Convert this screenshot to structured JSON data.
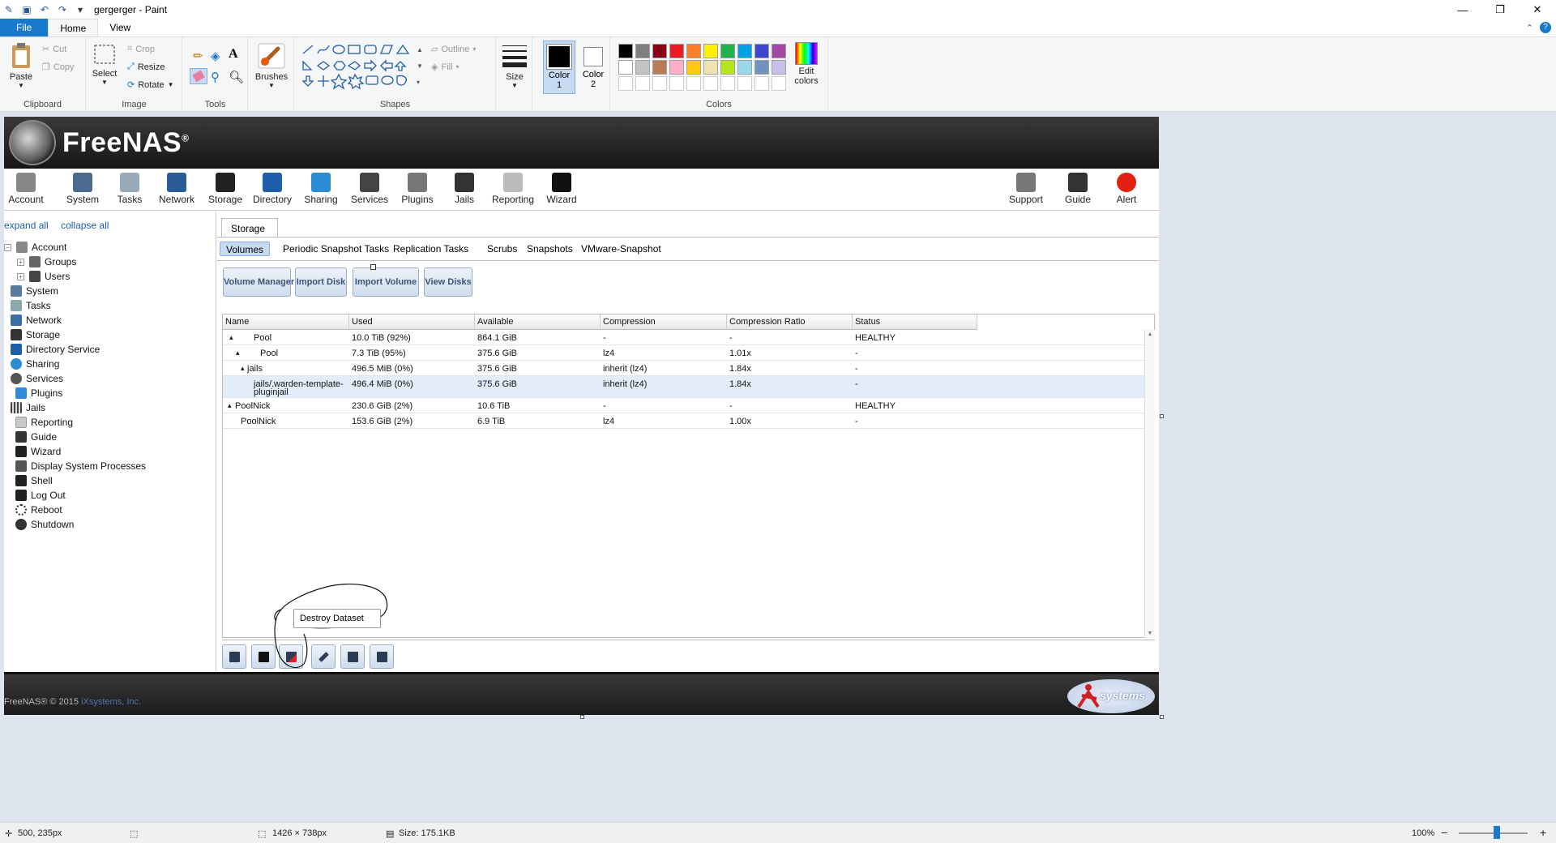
{
  "window": {
    "title": "gergerger - Paint",
    "min": "—",
    "max": "❐",
    "close": "✕"
  },
  "ribbon_tabs": {
    "file": "File",
    "home": "Home",
    "view": "View",
    "collapse": "⌃",
    "help": "?"
  },
  "ribbon": {
    "clipboard": {
      "label": "Clipboard",
      "paste": "Paste",
      "cut": "Cut",
      "copy": "Copy"
    },
    "image": {
      "label": "Image",
      "select": "Select",
      "crop": "Crop",
      "resize": "Resize",
      "rotate": "Rotate"
    },
    "tools": {
      "label": "Tools",
      "text_tool": "A"
    },
    "brushes": {
      "label": "Brushes"
    },
    "shapes": {
      "label": "Shapes",
      "outline": "Outline",
      "fill": "Fill"
    },
    "size": {
      "label": "Size"
    },
    "color1": {
      "label": "Color",
      "number": "1"
    },
    "color2": {
      "label": "Color",
      "number": "2"
    },
    "colors": {
      "label": "Colors",
      "edit_line1": "Edit",
      "edit_line2": "colors",
      "row1": [
        "#000000",
        "#7f7f7f",
        "#880015",
        "#ed1c24",
        "#ff7f27",
        "#fff200",
        "#22b14c",
        "#00a2e8",
        "#3f48cc",
        "#a349a4"
      ],
      "row2": [
        "#ffffff",
        "#c3c3c3",
        "#b97a57",
        "#ffaec9",
        "#ffc90e",
        "#efe4b0",
        "#b5e61d",
        "#99d9ea",
        "#7092be",
        "#c8bfe7"
      ]
    }
  },
  "freenas": {
    "brand": "FreeNAS",
    "trademark": "®",
    "nav": [
      "Account",
      "System",
      "Tasks",
      "Network",
      "Storage",
      "Directory",
      "Sharing",
      "Services",
      "Plugins",
      "Jails",
      "Reporting",
      "Wizard"
    ],
    "nav_right": [
      "Support",
      "Guide",
      "Alert"
    ],
    "tree_links": {
      "expand": "expand all",
      "collapse": "collapse all"
    },
    "tree": {
      "account": "Account",
      "groups": "Groups",
      "users": "Users",
      "system": "System",
      "tasks": "Tasks",
      "network": "Network",
      "storage": "Storage",
      "directory": "Directory Service",
      "sharing": "Sharing",
      "services": "Services",
      "plugins": "Plugins",
      "jails": "Jails",
      "reporting": "Reporting",
      "guide": "Guide",
      "wizard": "Wizard",
      "processes": "Display System Processes",
      "shell": "Shell",
      "logout": "Log Out",
      "reboot": "Reboot",
      "shutdown": "Shutdown"
    },
    "storage_tab": "Storage",
    "subtabs": [
      "Volumes",
      "Periodic Snapshot Tasks",
      "Replication Tasks",
      "Scrubs",
      "Snapshots",
      "VMware-Snapshot"
    ],
    "buttons": [
      "Volume Manager",
      "Import Disk",
      "Import Volume",
      "View Disks"
    ],
    "columns": [
      "Name",
      "Used",
      "Available",
      "Compression",
      "Compression Ratio",
      "Status"
    ],
    "rows": [
      {
        "name": "Pool",
        "used": "10.0 TiB (92%)",
        "available": "864.1 GiB",
        "compression": "-",
        "ratio": "-",
        "status": "HEALTHY"
      },
      {
        "name": "Pool",
        "used": "7.3 TiB (95%)",
        "available": "375.6 GiB",
        "compression": "lz4",
        "ratio": "1.01x",
        "status": "-"
      },
      {
        "name": "jails",
        "used": "496.5 MiB (0%)",
        "available": "375.6 GiB",
        "compression": "inherit (lz4)",
        "ratio": "1.84x",
        "status": "-"
      },
      {
        "name": "jails/.warden-template-",
        "name2": "pluginjail",
        "used": "496.4 MiB (0%)",
        "available": "375.6 GiB",
        "compression": "inherit (lz4)",
        "ratio": "1.84x",
        "status": "-"
      },
      {
        "name": "PoolNick",
        "used": "230.6 GiB (2%)",
        "available": "10.6 TiB",
        "compression": "-",
        "ratio": "-",
        "status": "HEALTHY"
      },
      {
        "name": "PoolNick",
        "used": "153.6 GiB (2%)",
        "available": "6.9 TiB",
        "compression": "lz4",
        "ratio": "1.00x",
        "status": "-"
      }
    ],
    "tooltip": "Destroy Dataset",
    "footer": {
      "copyright": "FreeNAS® © 2015 ",
      "company": "iXsystems, Inc.",
      "logo_text": "systems"
    }
  },
  "statusbar": {
    "cursor": "500, 235px",
    "dimensions": "1426 × 738px",
    "size": "Size: 175.1KB",
    "zoom": "100%",
    "zoom_out": "−",
    "zoom_in": "+"
  }
}
